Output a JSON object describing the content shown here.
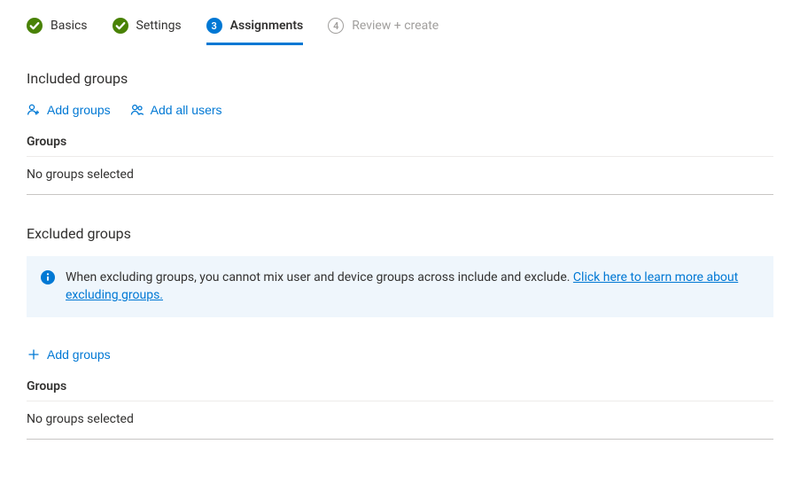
{
  "stepper": {
    "steps": [
      {
        "label": "Basics",
        "state": "done"
      },
      {
        "label": "Settings",
        "state": "done"
      },
      {
        "label": "Assignments",
        "state": "active",
        "number": "3"
      },
      {
        "label": "Review + create",
        "state": "future",
        "number": "4"
      }
    ]
  },
  "included": {
    "title": "Included groups",
    "addGroups": "Add groups",
    "addAllUsers": "Add all users",
    "tableHeader": "Groups",
    "empty": "No groups selected"
  },
  "excluded": {
    "title": "Excluded groups",
    "banner": {
      "text": "When excluding groups, you cannot mix user and device groups across include and exclude. ",
      "link": "Click here to learn more about excluding groups."
    },
    "addGroups": "Add groups",
    "tableHeader": "Groups",
    "empty": "No groups selected"
  }
}
